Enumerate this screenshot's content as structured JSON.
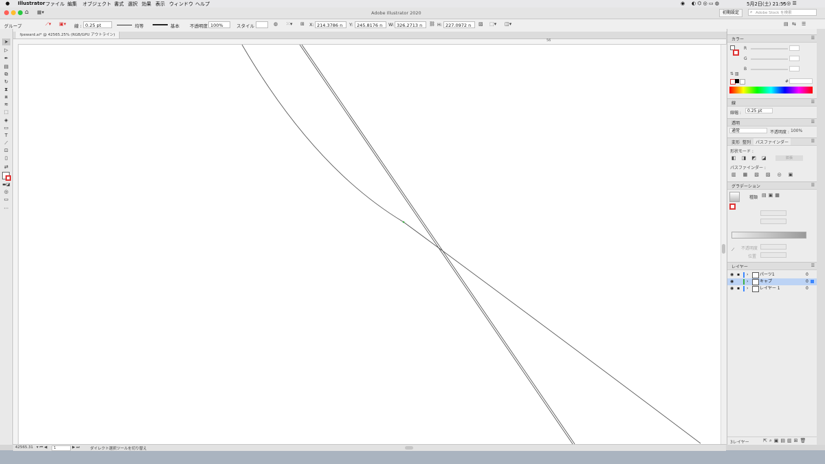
{
  "menubar": {
    "app": "Illustrator",
    "items": [
      "ファイル",
      "編集",
      "オブジェクト",
      "書式",
      "選択",
      "効果",
      "表示",
      "ウィンドウ",
      "ヘルプ"
    ],
    "clock": "5月2日(土) 21:55"
  },
  "window": {
    "title": "Adobe Illustrator 2020",
    "workspace": "初期設定",
    "search_placeholder": "Adobe Stock を検索"
  },
  "control_bar": {
    "selection_label": "グループ",
    "stroke_label": "線 :",
    "stroke_value": "0.25 pt",
    "profile_label": "均等",
    "brush_label": "基本",
    "opacity_label": "不透明度 :",
    "opacity_value": "100%",
    "style_label": "スタイル :",
    "x_label": "X:",
    "x_value": "214.3786 n",
    "y_label": "Y:",
    "y_value": "245.8176 n",
    "w_label": "W:",
    "w_value": "326.2713 n",
    "h_label": "H:",
    "h_value": "227.0972 n"
  },
  "document": {
    "tab": "fpeward.ai* @ 42565.25% (RGB/GPU アウトライン)",
    "ruler_mark": "56"
  },
  "status": {
    "zoom": "42565.31",
    "artboard": "1",
    "tool_hint": "ダイレクト選択ツールを切り替え"
  },
  "panels": {
    "color": {
      "title": "カラー",
      "r": "R",
      "g": "G",
      "b": "B",
      "hex_label": "#"
    },
    "stroke": {
      "title": "線",
      "weight_label": "線幅 :",
      "weight_value": "0.25 pt"
    },
    "transparency": {
      "title": "透明",
      "blend_mode": "通常",
      "opacity_label": "不透明度 :",
      "opacity_value": "100%"
    },
    "pathfinder": {
      "tabs": [
        "変形",
        "整列",
        "パスファインダー"
      ],
      "shape_modes_label": "形状モード :",
      "expand_label": "拡張",
      "pathfinders_label": "パスファインダー :"
    },
    "gradient": {
      "title": "グラデーション",
      "type_label": "種類",
      "opacity_label": "不透明度",
      "position_label": "位置"
    },
    "layers": {
      "title": "レイヤー",
      "items": [
        {
          "name": "パーツ1",
          "count": "0",
          "selected": false
        },
        {
          "name": "キャプ",
          "count": "0",
          "selected": true
        },
        {
          "name": "レイヤー 1",
          "count": "0",
          "selected": false
        }
      ],
      "footer": "3レイヤー"
    }
  },
  "colors": {
    "accent": "#3a86ff",
    "selection_row": "#bcd3f5",
    "canvas": "#ffffff",
    "path_stroke": "#444444",
    "anchor": "#3cb043"
  }
}
